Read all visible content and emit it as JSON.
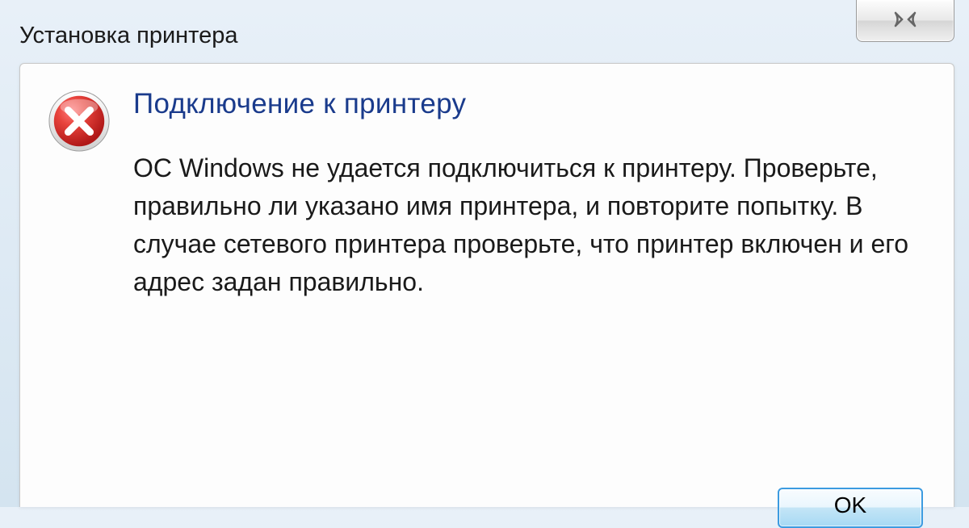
{
  "window": {
    "title": "Установка принтера"
  },
  "dialog": {
    "heading": "Подключение к принтеру",
    "body": "ОС Windows не удается подключиться к принтеру. Проверьте, правильно ли указано имя принтера, и повторите попытку. В случае сетевого принтера проверьте, что принтер включен и его адрес задан правильно."
  },
  "buttons": {
    "ok": "OK",
    "close_glyph": "✕"
  },
  "colors": {
    "heading": "#1a3b8c",
    "error_red": "#d4252a",
    "accent_blue": "#3c9be0"
  }
}
